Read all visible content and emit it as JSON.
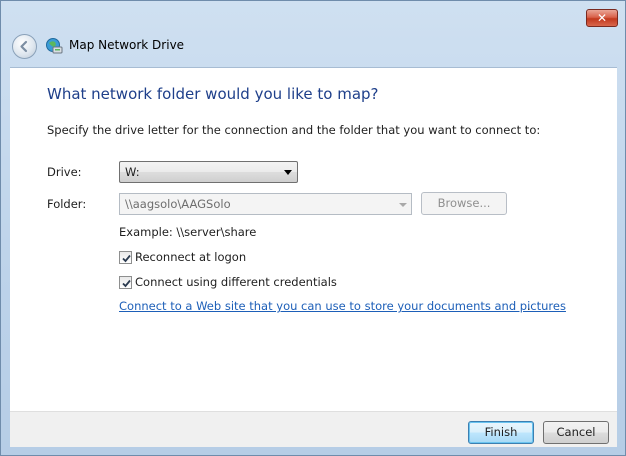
{
  "window": {
    "title": "Map Network Drive",
    "close_label": "✕",
    "accent": "#1e3f8a"
  },
  "main": {
    "heading": "What network folder would you like to map?",
    "instruction": "Specify the drive letter for the connection and the folder that you want to connect to:",
    "drive_label": "Drive:",
    "drive_value": "W:",
    "folder_label": "Folder:",
    "folder_value": "\\\\aagsolo\\AAGSolo",
    "browse_label": "Browse...",
    "example_text": "Example: \\\\server\\share",
    "reconnect": {
      "label": "Reconnect at logon",
      "checked": true
    },
    "credentials": {
      "label": "Connect using different credentials",
      "checked": true
    },
    "web_link_text": "Connect to a Web site that you can use to store your documents and pictures",
    "web_link_suffix": "."
  },
  "footer": {
    "finish_label": "Finish",
    "cancel_label": "Cancel"
  }
}
